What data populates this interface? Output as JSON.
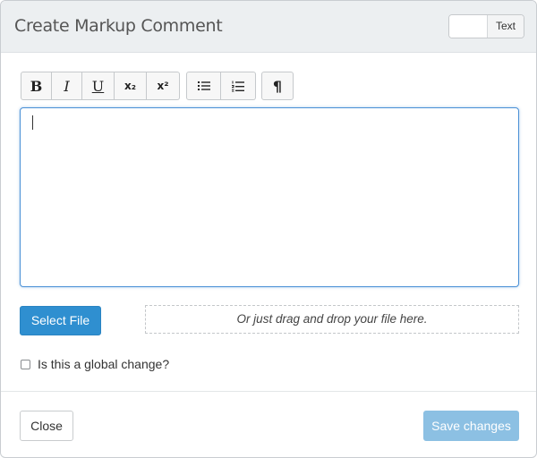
{
  "modal": {
    "title": "Create Markup Comment",
    "mode_toggle_label": "Text"
  },
  "toolbar": {
    "groups": [
      [
        {
          "name": "bold-button",
          "icon": "bold-icon",
          "glyph": "B"
        },
        {
          "name": "italic-button",
          "icon": "italic-icon",
          "glyph": "I"
        },
        {
          "name": "underline-button",
          "icon": "underline-icon",
          "glyph": "U"
        },
        {
          "name": "subscript-button",
          "icon": "subscript-icon",
          "glyph": "x₂"
        },
        {
          "name": "superscript-button",
          "icon": "superscript-icon",
          "glyph": "x²"
        }
      ],
      [
        {
          "name": "bullet-list-button",
          "icon": "bullet-list-icon",
          "glyph": ""
        },
        {
          "name": "numbered-list-button",
          "icon": "numbered-list-icon",
          "glyph": ""
        }
      ],
      [
        {
          "name": "paragraph-button",
          "icon": "pilcrow-icon",
          "glyph": "¶"
        }
      ]
    ]
  },
  "editor": {
    "value": ""
  },
  "upload": {
    "select_file_label": "Select File",
    "dropzone_text": "Or just drag and drop your file here."
  },
  "global_change": {
    "label": "Is this a global change?",
    "checked": false
  },
  "footer": {
    "close_label": "Close",
    "save_label": "Save changes"
  },
  "colors": {
    "primary": "#2f8fd0",
    "primary_disabled": "#8cc0e3",
    "header_bg": "#eceff1",
    "focus_border": "#4a90d6"
  }
}
